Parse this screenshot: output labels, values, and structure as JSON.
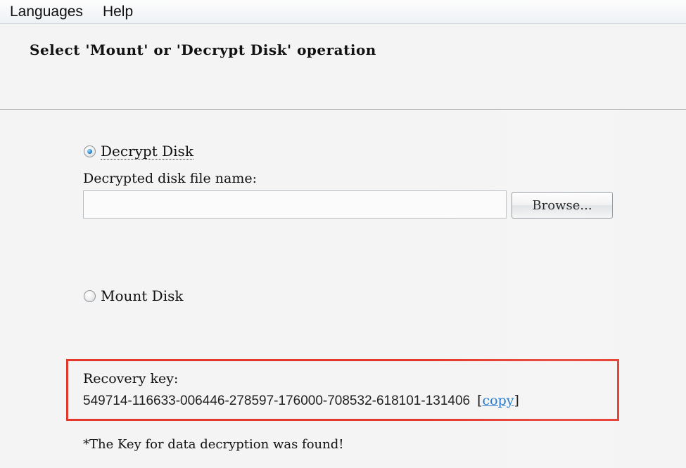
{
  "menu": {
    "items": [
      {
        "label": "Languages"
      },
      {
        "label": "Help"
      }
    ]
  },
  "header": {
    "title": "Select 'Mount' or 'Decrypt Disk' operation"
  },
  "options": {
    "decrypt": {
      "label": "Decrypt Disk",
      "selected": true
    },
    "file": {
      "label": "Decrypted disk file name:",
      "value": "",
      "placeholder": ""
    },
    "browse": {
      "label": "Browse..."
    },
    "mount": {
      "label": "Mount Disk",
      "selected": false
    }
  },
  "recovery": {
    "label": "Recovery key:",
    "key": "549714-116633-006446-278597-176000-708532-618101-131406",
    "copy_open": "[",
    "copy_label": "copy",
    "copy_close": "]"
  },
  "status": {
    "message": "*The Key for data decryption was found!"
  },
  "colors": {
    "highlight_border": "#e5382d",
    "link": "#1a73c8",
    "selected_radio": "#2f86cc"
  },
  "icons": {
    "decrypt_radio": "radio-checked-icon",
    "mount_radio": "radio-unchecked-icon"
  }
}
